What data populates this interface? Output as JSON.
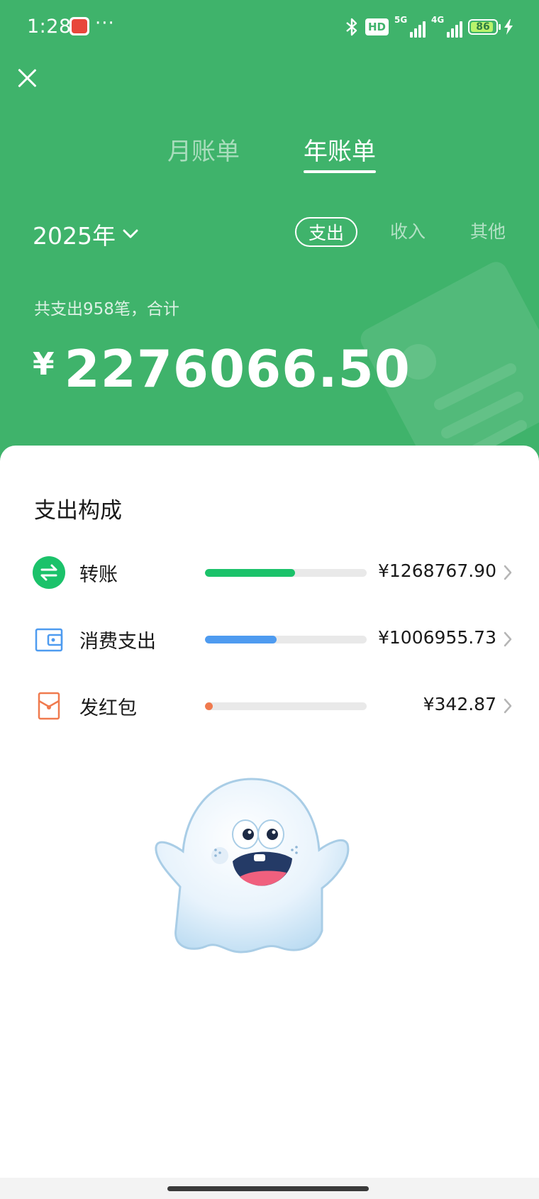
{
  "status_bar": {
    "time": "1:28",
    "more": "···",
    "hd_label": "HD",
    "network_5g": "5G",
    "network_4g": "4G",
    "battery": "86"
  },
  "tabs": [
    {
      "label": "月账单",
      "active": false
    },
    {
      "label": "年账单",
      "active": true
    }
  ],
  "year_selector": {
    "label": "2025年"
  },
  "filters": [
    {
      "label": "支出",
      "active": true
    },
    {
      "label": "收入",
      "active": false
    },
    {
      "label": "其他",
      "active": false
    }
  ],
  "summary": {
    "text": "共支出958笔，合计",
    "currency": "¥",
    "total": "2276066.50"
  },
  "composition": {
    "title": "支出构成",
    "items": [
      {
        "label": "转账",
        "amount": "¥1268767.90",
        "share": 0.557,
        "color": "#1bc26a",
        "icon": "transfer-icon"
      },
      {
        "label": "消费支出",
        "amount": "¥1006955.73",
        "share": 0.442,
        "color": "#4e9bf0",
        "icon": "wallet-icon"
      },
      {
        "label": "发红包",
        "amount": "¥342.87",
        "share": 0.0002,
        "color": "#f07a4e",
        "icon": "red-packet-icon"
      }
    ]
  },
  "colors": {
    "brand_green": "#3fb36b",
    "transfer_green": "#1bc26a",
    "consumption_blue": "#4e9bf0",
    "red_packet_orange": "#f07a4e"
  }
}
